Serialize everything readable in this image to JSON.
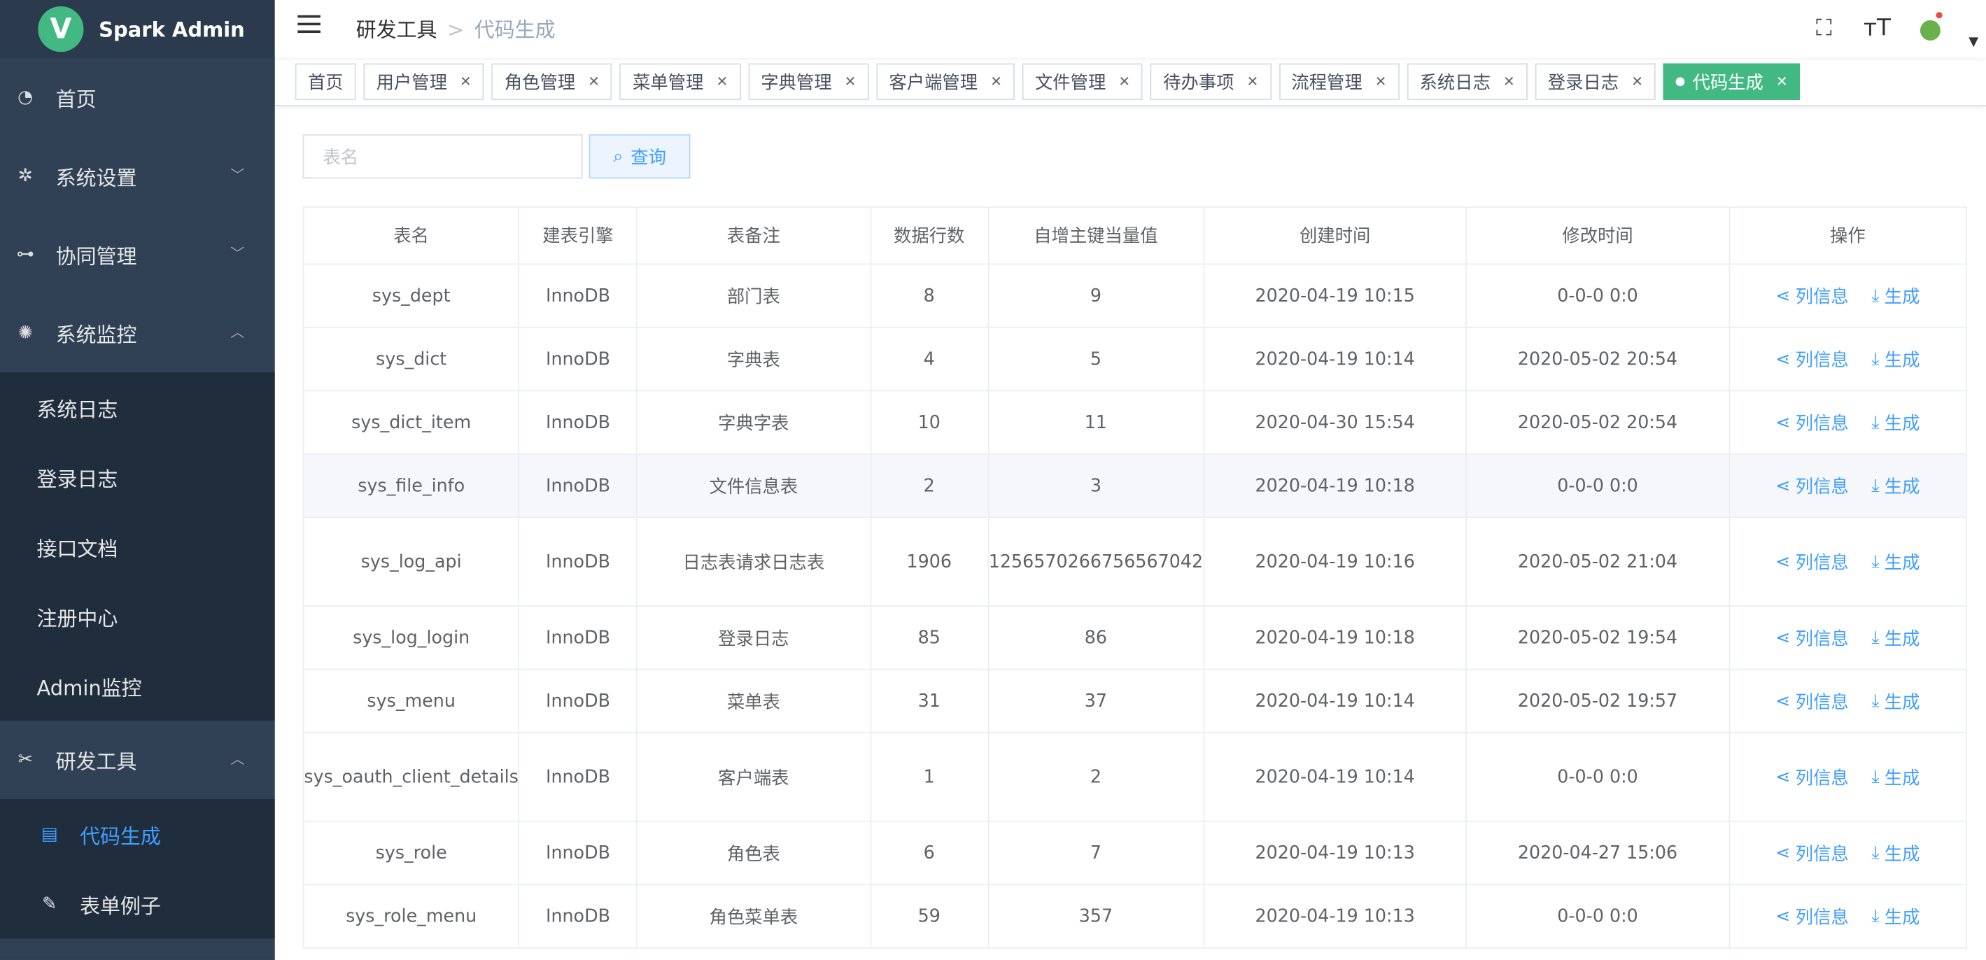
{
  "brand": {
    "logo_letter": "V",
    "title": "Spark Admin"
  },
  "sidebar": {
    "items": [
      {
        "label": "首页",
        "icon": "dashboard-icon"
      },
      {
        "label": "系统设置",
        "icon": "settings-icon"
      },
      {
        "label": "协同管理",
        "icon": "flow-icon"
      },
      {
        "label": "系统监控",
        "icon": "monitor-icon"
      }
    ],
    "monitor_sub": [
      "系统日志",
      "登录日志",
      "接口文档",
      "注册中心",
      "Admin监控"
    ],
    "devtools": "研发工具",
    "devtools_sub": [
      {
        "label": "代码生成",
        "active": true
      },
      {
        "label": "表单例子",
        "active": false
      }
    ]
  },
  "header": {
    "crumb_parent": "研发工具",
    "crumb_sep": ">",
    "crumb_current": "代码生成"
  },
  "tags": [
    "首页",
    "用户管理",
    "角色管理",
    "菜单管理",
    "字典管理",
    "客户端管理",
    "文件管理",
    "待办事项",
    "流程管理",
    "系统日志",
    "登录日志",
    "代码生成"
  ],
  "search": {
    "placeholder": "表名",
    "button": "查询"
  },
  "table": {
    "columns": [
      "表名",
      "建表引擎",
      "表备注",
      "数据行数",
      "自增主键当量值",
      "创建时间",
      "修改时间",
      "操作"
    ],
    "ops": {
      "info": "列信息",
      "gen": "生成"
    },
    "rows": [
      [
        "sys_dept",
        "InnoDB",
        "部门表",
        "8",
        "9",
        "2020-04-19 10:15",
        "0-0-0 0:0"
      ],
      [
        "sys_dict",
        "InnoDB",
        "字典表",
        "4",
        "5",
        "2020-04-19 10:14",
        "2020-05-02 20:54"
      ],
      [
        "sys_dict_item",
        "InnoDB",
        "字典字表",
        "10",
        "11",
        "2020-04-30 15:54",
        "2020-05-02 20:54"
      ],
      [
        "sys_file_info",
        "InnoDB",
        "文件信息表",
        "2",
        "3",
        "2020-04-19 10:18",
        "0-0-0 0:0"
      ],
      [
        "sys_log_api",
        "InnoDB",
        "日志表请求日志表",
        "1906",
        "1256570266756567042",
        "2020-04-19 10:16",
        "2020-05-02 21:04"
      ],
      [
        "sys_log_login",
        "InnoDB",
        "登录日志",
        "85",
        "86",
        "2020-04-19 10:18",
        "2020-05-02 19:54"
      ],
      [
        "sys_menu",
        "InnoDB",
        "菜单表",
        "31",
        "37",
        "2020-04-19 10:14",
        "2020-05-02 19:57"
      ],
      [
        "sys_oauth_client_details",
        "InnoDB",
        "客户端表",
        "1",
        "2",
        "2020-04-19 10:14",
        "0-0-0 0:0"
      ],
      [
        "sys_role",
        "InnoDB",
        "角色表",
        "6",
        "7",
        "2020-04-19 10:13",
        "2020-04-27 15:06"
      ],
      [
        "sys_role_menu",
        "InnoDB",
        "角色菜单表",
        "59",
        "357",
        "2020-04-19 10:13",
        "0-0-0 0:0"
      ]
    ]
  }
}
